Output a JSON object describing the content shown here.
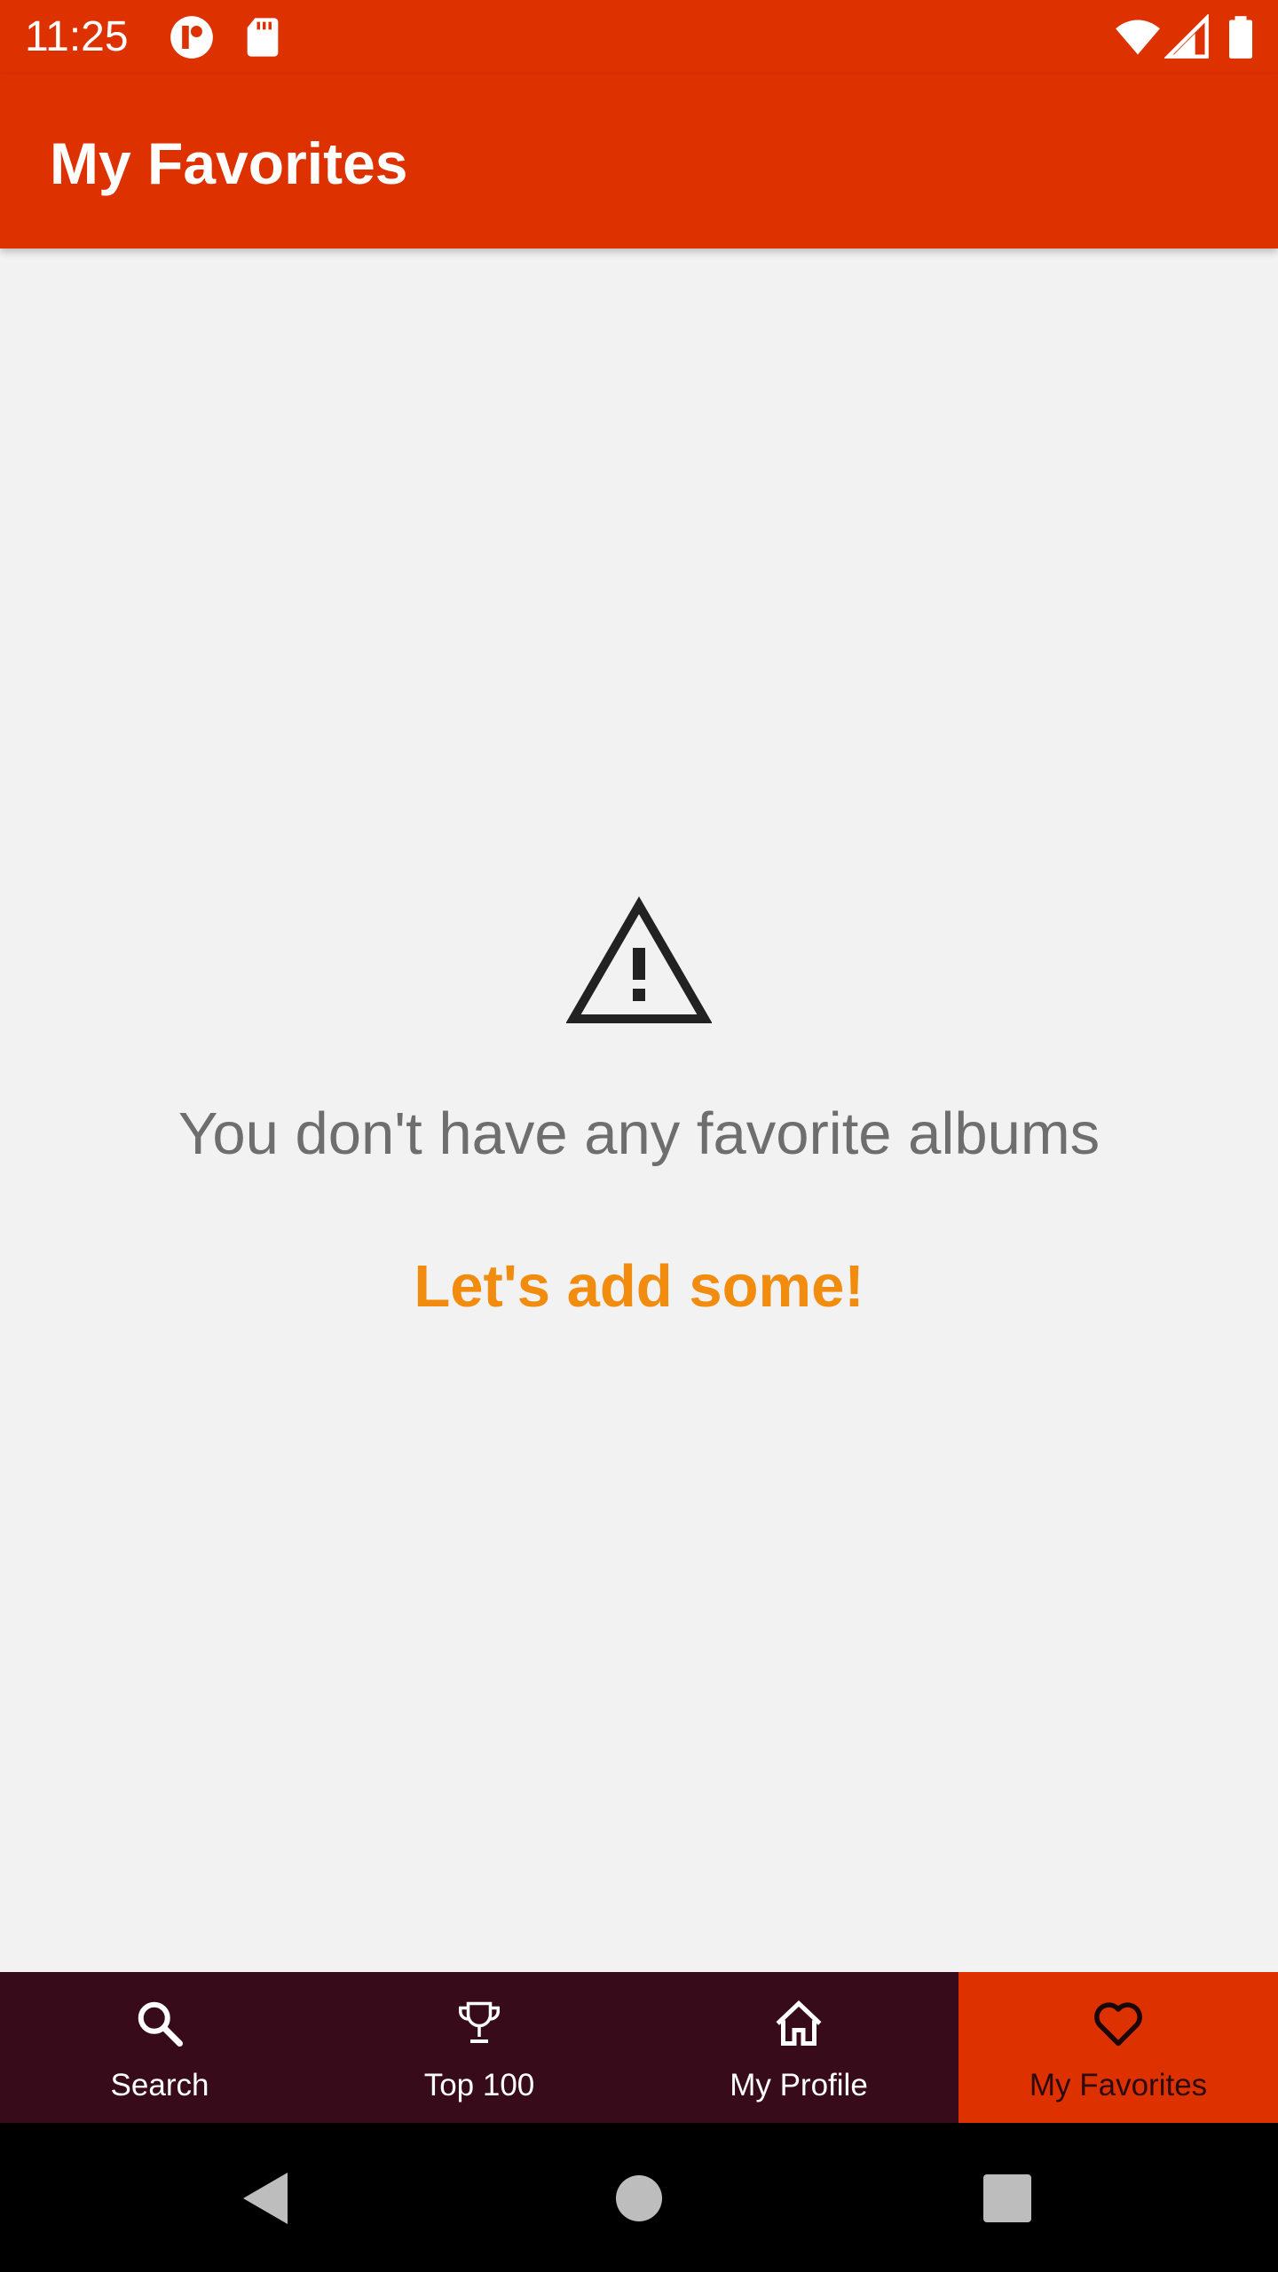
{
  "status_bar": {
    "time": "11:25",
    "icons": [
      "notification-app-icon",
      "sd-card-icon",
      "wifi-icon",
      "cellular-signal-icon",
      "battery-icon"
    ]
  },
  "app_bar": {
    "title": "My Favorites"
  },
  "empty_state": {
    "icon": "warning-icon",
    "message": "You don't have any favorite albums",
    "action_label": "Let's add some!"
  },
  "bottom_nav": {
    "items": [
      {
        "label": "Search",
        "icon": "search-icon",
        "active": false
      },
      {
        "label": "Top 100",
        "icon": "trophy-icon",
        "active": false
      },
      {
        "label": "My Profile",
        "icon": "home-icon",
        "active": false
      },
      {
        "label": "My Favorites",
        "icon": "heart-icon",
        "active": true
      }
    ]
  },
  "system_nav": {
    "buttons": [
      "back-icon",
      "home-circle-icon",
      "recents-icon"
    ]
  },
  "colors": {
    "primary": "#dd3100",
    "background": "#f2f2f2",
    "nav_background": "#380b1a",
    "accent": "#f28c0f",
    "message_text": "#6e6e6e"
  }
}
